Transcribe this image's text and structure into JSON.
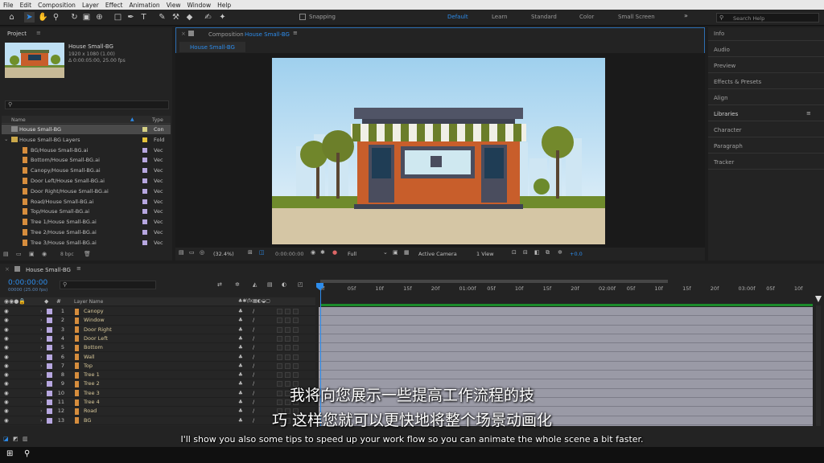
{
  "menu": [
    "File",
    "Edit",
    "Composition",
    "Layer",
    "Effect",
    "Animation",
    "View",
    "Window",
    "Help"
  ],
  "toolbar": {
    "snapping_label": "Snapping",
    "workspaces": [
      "Default",
      "Learn",
      "Standard",
      "Color",
      "Small Screen"
    ],
    "active_workspace": "Default",
    "search_placeholder": "Search Help"
  },
  "project": {
    "title": "Project",
    "comp_name": "House Small-BG",
    "comp_info1": "1920 x 1080 (1.00)",
    "comp_info2": "Δ 0:00:05:00, 25.00 fps",
    "search_placeholder": "",
    "col_name": "Name",
    "col_type": "Type",
    "items": [
      {
        "name": "House Small-BG",
        "type": "Con",
        "selected": true,
        "indent": 0,
        "label": "#d4cf84"
      },
      {
        "name": "House Small-BG Layers",
        "type": "Fold",
        "selected": false,
        "indent": 0,
        "label": "#e4c23a"
      },
      {
        "name": "BG/House Small-BG.ai",
        "type": "Vec",
        "selected": false,
        "indent": 1,
        "label": "#b7a7e0"
      },
      {
        "name": "Bottom/House Small-BG.ai",
        "type": "Vec",
        "selected": false,
        "indent": 1,
        "label": "#b7a7e0"
      },
      {
        "name": "Canopy/House Small-BG.ai",
        "type": "Vec",
        "selected": false,
        "indent": 1,
        "label": "#b7a7e0"
      },
      {
        "name": "Door Left/House Small-BG.ai",
        "type": "Vec",
        "selected": false,
        "indent": 1,
        "label": "#b7a7e0"
      },
      {
        "name": "Door Right/House Small-BG.ai",
        "type": "Vec",
        "selected": false,
        "indent": 1,
        "label": "#b7a7e0"
      },
      {
        "name": "Road/House Small-BG.ai",
        "type": "Vec",
        "selected": false,
        "indent": 1,
        "label": "#b7a7e0"
      },
      {
        "name": "Top/House Small-BG.ai",
        "type": "Vec",
        "selected": false,
        "indent": 1,
        "label": "#b7a7e0"
      },
      {
        "name": "Tree 1/House Small-BG.ai",
        "type": "Vec",
        "selected": false,
        "indent": 1,
        "label": "#b7a7e0"
      },
      {
        "name": "Tree 2/House Small-BG.ai",
        "type": "Vec",
        "selected": false,
        "indent": 1,
        "label": "#b7a7e0"
      },
      {
        "name": "Tree 3/House Small-BG.ai",
        "type": "Vec",
        "selected": false,
        "indent": 1,
        "label": "#b7a7e0"
      }
    ],
    "bpc": "8 bpc"
  },
  "composition": {
    "panel_label": "Composition",
    "comp_name": "House Small-BG",
    "tab": "House Small-BG",
    "zoom": "(32.4%)",
    "timecode": "0:00:00:00",
    "resolution": "Full",
    "camera": "Active Camera",
    "views": "1 View",
    "exposure": "+0.0"
  },
  "right_panels": [
    "Info",
    "Audio",
    "Preview",
    "Effects & Presets",
    "Align",
    "Libraries",
    "Character",
    "Paragraph",
    "Tracker"
  ],
  "timeline": {
    "tab": "House Small-BG",
    "timecode": "0:00:00:00",
    "timecode_sub": "00000 (25.00 fps)",
    "layer_name_header": "Layer Name",
    "ruler": [
      "0f",
      "05f",
      "10f",
      "15f",
      "20f",
      "01:00f",
      "05f",
      "10f",
      "15f",
      "20f",
      "02:00f",
      "05f",
      "10f",
      "15f",
      "20f",
      "03:00f",
      "05f",
      "10f"
    ],
    "layers": [
      {
        "num": "1",
        "name": "Canopy"
      },
      {
        "num": "2",
        "name": "Window"
      },
      {
        "num": "3",
        "name": "Door Right"
      },
      {
        "num": "4",
        "name": "Door Left"
      },
      {
        "num": "5",
        "name": "Bottom"
      },
      {
        "num": "6",
        "name": "Wall"
      },
      {
        "num": "7",
        "name": "Top"
      },
      {
        "num": "8",
        "name": "Tree 1"
      },
      {
        "num": "9",
        "name": "Tree 2"
      },
      {
        "num": "10",
        "name": "Tree 3"
      },
      {
        "num": "11",
        "name": "Tree 4"
      },
      {
        "num": "12",
        "name": "Road"
      },
      {
        "num": "13",
        "name": "BG"
      }
    ]
  },
  "subtitles": {
    "cn_line1": "我将向您展示一些提高工作流程的技",
    "cn_line2": "巧 这样您就可以更快地将整个场景动画化",
    "en": "I'll show you also some tips to speed up your work flow so you can animate the whole scene a bit faster."
  },
  "colors": {
    "accent": "#2d8ceb",
    "layer_label": "#b7a7e0",
    "ai_file": "#d68d3d"
  }
}
